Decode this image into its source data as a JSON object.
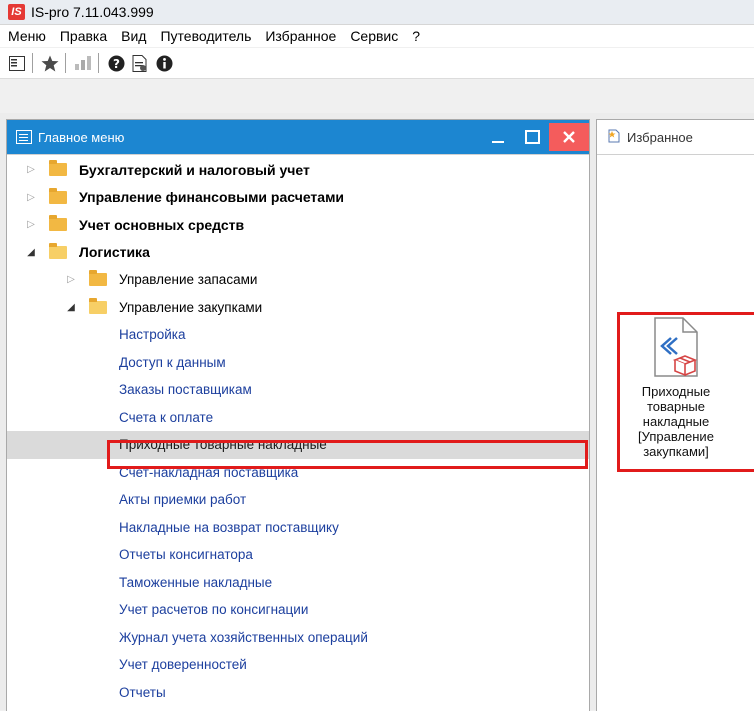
{
  "app": {
    "logo": "IS",
    "title": "IS-pro 7.11.043.999"
  },
  "menubar": [
    "Меню",
    "Правка",
    "Вид",
    "Путеводитель",
    "Избранное",
    "Сервис",
    "?"
  ],
  "toolbar": {
    "icons": [
      "panel-toggle-icon",
      "star-icon",
      "chart-icon",
      "help-icon",
      "properties-icon",
      "info-icon"
    ]
  },
  "left_panel": {
    "title": "Главное меню",
    "controls": {
      "minimize": "_",
      "maximize": "□",
      "close": "✕"
    },
    "tree": [
      {
        "label": "Бухгалтерский и налоговый учет",
        "level": 0,
        "type": "folder",
        "expanded": false
      },
      {
        "label": "Управление финансовыми расчетами",
        "level": 0,
        "type": "folder",
        "expanded": false
      },
      {
        "label": "Учет основных средств",
        "level": 0,
        "type": "folder",
        "expanded": false
      },
      {
        "label": "Логистика",
        "level": 0,
        "type": "folder",
        "expanded": true
      },
      {
        "label": "Управление запасами",
        "level": 1,
        "type": "folder",
        "expanded": false
      },
      {
        "label": "Управление закупками",
        "level": 1,
        "type": "folder",
        "expanded": true
      },
      {
        "label": "Настройка",
        "level": 2,
        "type": "leaf"
      },
      {
        "label": "Доступ к данным",
        "level": 2,
        "type": "leaf"
      },
      {
        "label": "Заказы поставщикам",
        "level": 2,
        "type": "leaf"
      },
      {
        "label": "Счета к оплате",
        "level": 2,
        "type": "leaf"
      },
      {
        "label": "Приходные товарные накладные",
        "level": 2,
        "type": "leaf",
        "selected": true
      },
      {
        "label": "Счет-накладная поставщика",
        "level": 2,
        "type": "leaf"
      },
      {
        "label": "Акты приемки работ",
        "level": 2,
        "type": "leaf"
      },
      {
        "label": "Накладные на возврат поставщику",
        "level": 2,
        "type": "leaf"
      },
      {
        "label": "Отчеты консигнатора",
        "level": 2,
        "type": "leaf"
      },
      {
        "label": "Таможенные накладные",
        "level": 2,
        "type": "leaf"
      },
      {
        "label": "Учет расчетов по консигнации",
        "level": 2,
        "type": "leaf"
      },
      {
        "label": "Журнал учета хозяйственных операций",
        "level": 2,
        "type": "leaf"
      },
      {
        "label": "Учет доверенностей",
        "level": 2,
        "type": "leaf"
      },
      {
        "label": "Отчеты",
        "level": 2,
        "type": "leaf"
      }
    ]
  },
  "right_panel": {
    "title": "Избранное",
    "tile": {
      "label": "Приходные товарные накладные [Управление закупками]"
    }
  },
  "colors": {
    "header_blue": "#1c86d1",
    "link_blue": "#1c3f9e",
    "highlight_red": "#e11b1b",
    "close_red": "#f45c5c"
  }
}
